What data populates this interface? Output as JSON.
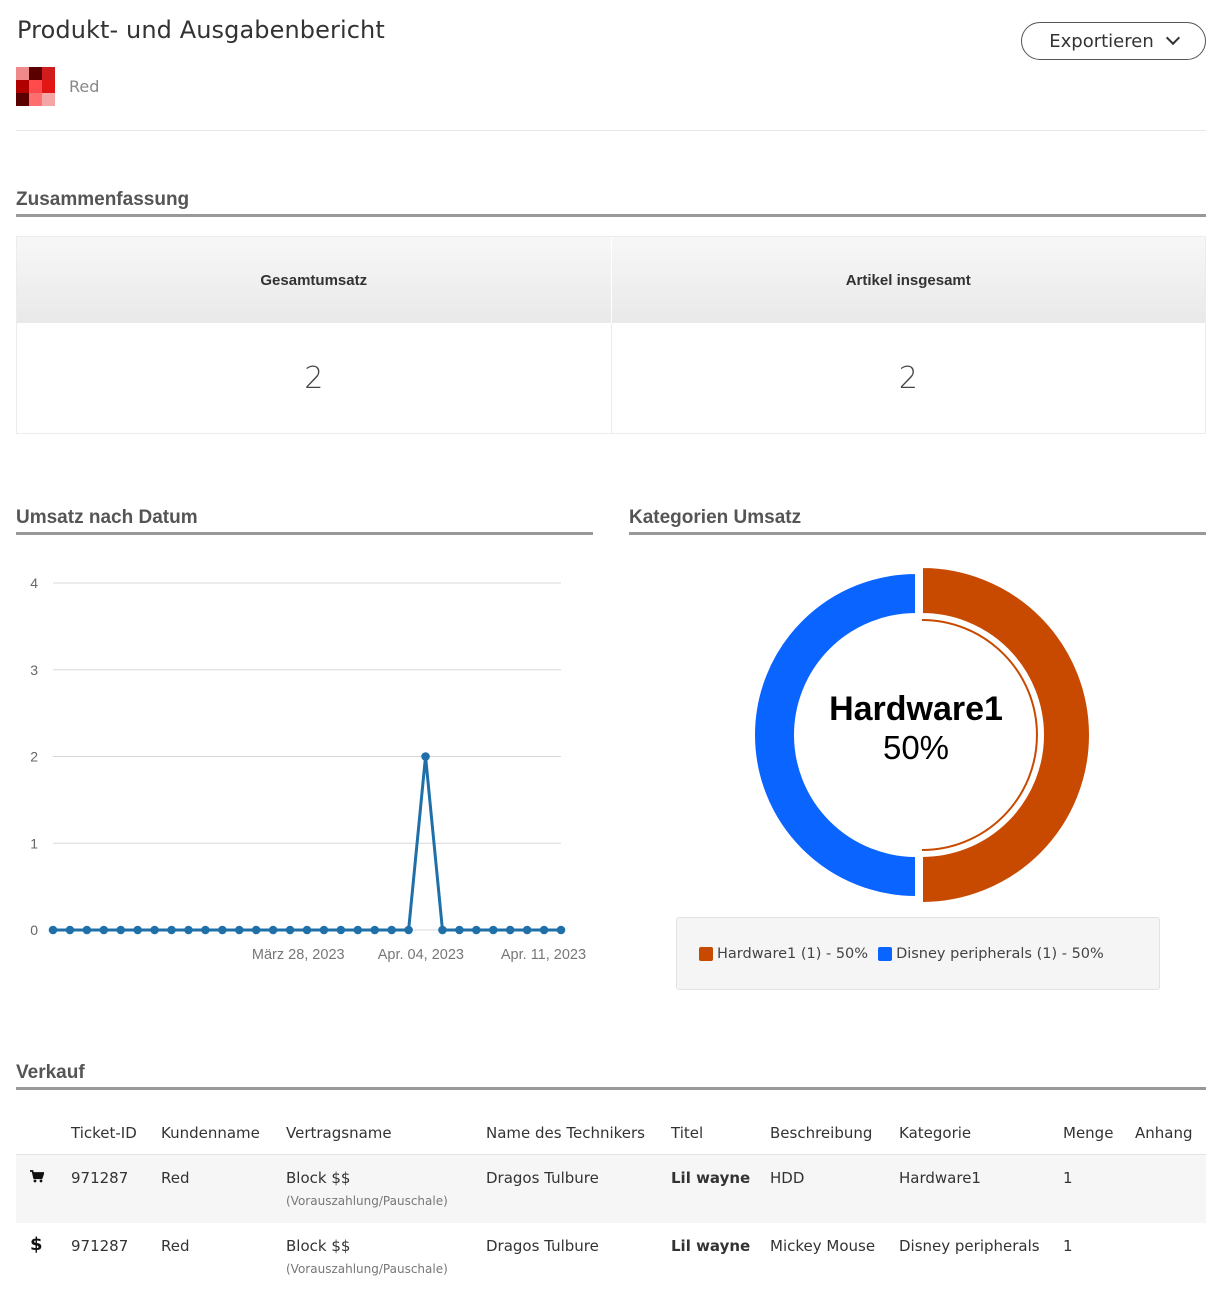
{
  "header": {
    "title": "Produkt- und Ausgabenbericht",
    "export_label": "Exportieren",
    "customer_name": "Red",
    "avatar_colors": [
      "#f08a8a",
      "#5a0000",
      "#d01c1c",
      "#b00000",
      "#ff4b4b",
      "#e31616",
      "#5a0000",
      "#ff6e6e",
      "#f4a6a6"
    ]
  },
  "summary": {
    "title": "Zusammenfassung",
    "col1_label": "Gesamtumsatz",
    "col1_value": "2",
    "col2_label": "Artikel insgesamt",
    "col2_value": "2"
  },
  "revenue_by_date": {
    "title": "Umsatz nach Datum"
  },
  "category_revenue": {
    "title": "Kategorien Umsatz",
    "center_label": "Hardware1",
    "center_pct": "50%",
    "legend": [
      {
        "label": "Hardware1 (1) - 50%",
        "color": "#c84a00"
      },
      {
        "label": "Disney peripherals (1) - 50%",
        "color": "#0a64ff"
      }
    ]
  },
  "chart_data": [
    {
      "type": "line",
      "ylim": [
        0,
        4
      ],
      "yticks": [
        "0",
        "1",
        "2",
        "3",
        "4"
      ],
      "xtick_labels": [
        "März 28, 2023",
        "Apr. 04, 2023",
        "Apr. 11, 2023"
      ],
      "x": [
        "2023-03-14",
        "2023-03-15",
        "2023-03-16",
        "2023-03-17",
        "2023-03-18",
        "2023-03-19",
        "2023-03-20",
        "2023-03-21",
        "2023-03-22",
        "2023-03-23",
        "2023-03-24",
        "2023-03-25",
        "2023-03-26",
        "2023-03-27",
        "2023-03-28",
        "2023-03-29",
        "2023-03-30",
        "2023-03-31",
        "2023-04-01",
        "2023-04-02",
        "2023-04-03",
        "2023-04-04",
        "2023-04-05",
        "2023-04-06",
        "2023-04-07",
        "2023-04-08",
        "2023-04-09",
        "2023-04-10",
        "2023-04-11",
        "2023-04-12"
      ],
      "values": [
        0,
        0,
        0,
        0,
        0,
        0,
        0,
        0,
        0,
        0,
        0,
        0,
        0,
        0,
        0,
        0,
        0,
        0,
        0,
        0,
        0,
        0,
        2,
        0,
        0,
        0,
        0,
        0,
        0,
        0,
        0
      ],
      "color": "#1f6fa8",
      "grid": true
    },
    {
      "type": "pie",
      "categories": [
        "Hardware1",
        "Disney peripherals"
      ],
      "values": [
        1,
        1
      ],
      "colors": [
        "#c84a00",
        "#0a64ff"
      ],
      "donut": true
    }
  ],
  "sales": {
    "title": "Verkauf",
    "columns": [
      "",
      "Ticket-ID",
      "Kundenname",
      "Vertragsname",
      "Name des Technikers",
      "Titel",
      "Beschreibung",
      "Kategorie",
      "Menge",
      "Anhang"
    ],
    "rows": [
      {
        "icon": "cart-icon",
        "ticket_id": "971287",
        "customer": "Red",
        "contract": "Block $$",
        "contract_sub": "(Vorauszahlung/Pauschale)",
        "technician": "Dragos Tulbure",
        "title": "Lil wayne",
        "description": "HDD",
        "category": "Hardware1",
        "qty": "1",
        "attachment": ""
      },
      {
        "icon": "dollar-icon",
        "ticket_id": "971287",
        "customer": "Red",
        "contract": "Block $$",
        "contract_sub": "(Vorauszahlung/Pauschale)",
        "technician": "Dragos Tulbure",
        "title": "Lil wayne",
        "description": "Mickey Mouse",
        "category": "Disney peripherals",
        "qty": "1",
        "attachment": ""
      }
    ]
  }
}
